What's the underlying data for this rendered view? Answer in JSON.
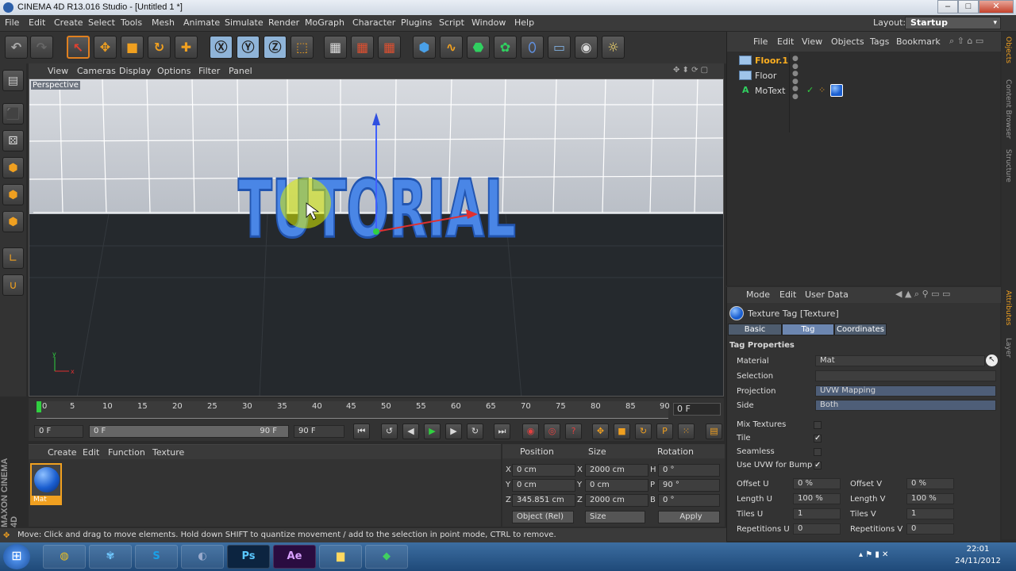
{
  "window": {
    "title": "CINEMA 4D R13.016 Studio - [Untitled 1 *]",
    "min": "–",
    "max": "□",
    "close": "✕"
  },
  "menu": [
    "File",
    "Edit",
    "Create",
    "Select",
    "Tools",
    "Mesh",
    "Animate",
    "Simulate",
    "Render",
    "MoGraph",
    "Character",
    "Plugins",
    "Script",
    "Window",
    "Help"
  ],
  "layout": {
    "label": "Layout:",
    "value": "Startup"
  },
  "viewport": {
    "menu": [
      "View",
      "Cameras",
      "Display",
      "Options",
      "Filter",
      "Panel"
    ],
    "label": "Perspective",
    "text3d": "TUTORIAL",
    "axis_y": "y",
    "axis_x": "x"
  },
  "timeline": {
    "ticks": [
      "0",
      "5",
      "10",
      "15",
      "20",
      "25",
      "30",
      "35",
      "40",
      "45",
      "50",
      "55",
      "60",
      "65",
      "70",
      "75",
      "80",
      "85",
      "90"
    ],
    "current_frame": "0 F"
  },
  "transport": {
    "start": "0 F",
    "range_start": "0 F",
    "range_end": "90 F",
    "end": "90 F"
  },
  "material_manager": {
    "menu": [
      "Create",
      "Edit",
      "Function",
      "Texture"
    ],
    "material_name": "Mat"
  },
  "brand": "MAXON CINEMA 4D",
  "coords": {
    "headers": [
      "Position",
      "Size",
      "Rotation"
    ],
    "rows": [
      {
        "axis": "X",
        "pos": "0 cm",
        "saxis": "X",
        "size": "2000 cm",
        "raxis": "H",
        "rot": "0 °"
      },
      {
        "axis": "Y",
        "pos": "0 cm",
        "saxis": "Y",
        "size": "0 cm",
        "raxis": "P",
        "rot": "90 °"
      },
      {
        "axis": "Z",
        "pos": "345.851 cm",
        "saxis": "Z",
        "size": "2000 cm",
        "raxis": "B",
        "rot": "0 °"
      }
    ],
    "mode": "Object (Rel)",
    "size_mode": "Size",
    "apply": "Apply"
  },
  "object_manager": {
    "menu": [
      "File",
      "Edit",
      "View",
      "Objects",
      "Tags",
      "Bookmark"
    ],
    "objects": [
      "Floor.1",
      "Floor",
      "MoText"
    ]
  },
  "attributes": {
    "menu": [
      "Mode",
      "Edit",
      "User Data"
    ],
    "title": "Texture Tag [Texture]",
    "tabs": [
      "Basic",
      "Tag",
      "Coordinates"
    ],
    "section": "Tag Properties",
    "material_label": "Material",
    "material_value": "Mat",
    "selection_label": "Selection",
    "projection_label": "Projection",
    "projection_value": "UVW Mapping",
    "side_label": "Side",
    "side_value": "Both",
    "mix_label": "Mix Textures",
    "tile_label": "Tile",
    "seamless_label": "Seamless",
    "uvwbump_label": "Use UVW for Bump",
    "offset_u_label": "Offset U",
    "offset_u": "0 %",
    "offset_v_label": "Offset V",
    "offset_v": "0 %",
    "length_u_label": "Length U",
    "length_u": "100 %",
    "length_v_label": "Length V",
    "length_v": "100 %",
    "tiles_u_label": "Tiles U",
    "tiles_u": "1",
    "tiles_v_label": "Tiles V",
    "tiles_v": "1",
    "rep_u_label": "Repetitions U",
    "rep_u": "0",
    "rep_v_label": "Repetitions V",
    "rep_v": "0"
  },
  "side_tabs": [
    "Objects",
    "Content Browser",
    "Structure",
    "Attributes",
    "Layer"
  ],
  "status": "Move: Click and drag to move elements. Hold down SHIFT to quantize movement / add to the selection in point mode, CTRL to remove.",
  "taskbar": {
    "clock": "22:01",
    "date": "24/11/2012",
    "apps": [
      "Ps",
      "Ae"
    ]
  }
}
